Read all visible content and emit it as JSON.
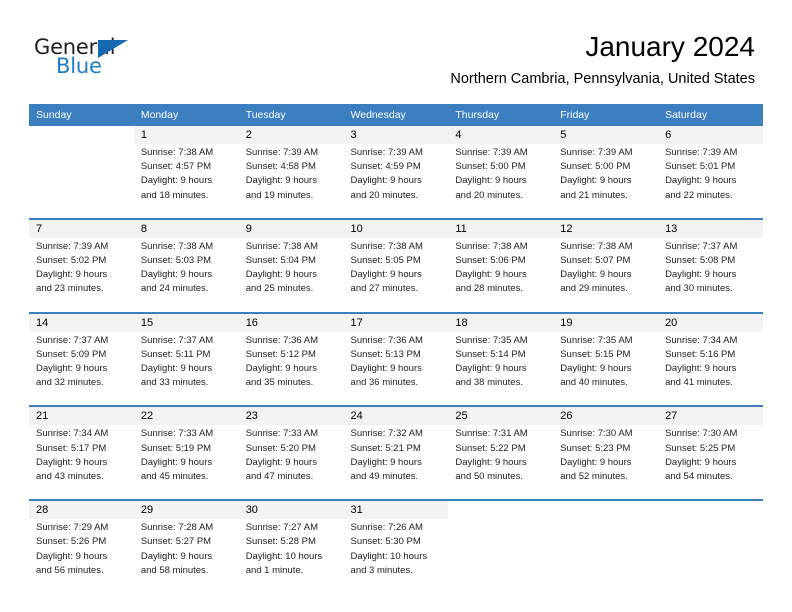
{
  "brand": {
    "name_top": "General",
    "name_bottom": "Blue",
    "accent_color": "#1668b0",
    "text_color": "#231f20"
  },
  "header": {
    "title": "January 2024",
    "subtitle": "Northern Cambria, Pennsylvania, United States",
    "header_bg": "#3c7fc0",
    "daynum_bg": "#f2f2f2"
  },
  "weekdays": [
    "Sunday",
    "Monday",
    "Tuesday",
    "Wednesday",
    "Thursday",
    "Friday",
    "Saturday"
  ],
  "weeks": [
    {
      "days": [
        {
          "date": "",
          "sunrise": "",
          "sunset": "",
          "daylight1": "",
          "daylight2": ""
        },
        {
          "date": "1",
          "sunrise": "Sunrise: 7:38 AM",
          "sunset": "Sunset: 4:57 PM",
          "daylight1": "Daylight: 9 hours",
          "daylight2": "and 18 minutes."
        },
        {
          "date": "2",
          "sunrise": "Sunrise: 7:39 AM",
          "sunset": "Sunset: 4:58 PM",
          "daylight1": "Daylight: 9 hours",
          "daylight2": "and 19 minutes."
        },
        {
          "date": "3",
          "sunrise": "Sunrise: 7:39 AM",
          "sunset": "Sunset: 4:59 PM",
          "daylight1": "Daylight: 9 hours",
          "daylight2": "and 20 minutes."
        },
        {
          "date": "4",
          "sunrise": "Sunrise: 7:39 AM",
          "sunset": "Sunset: 5:00 PM",
          "daylight1": "Daylight: 9 hours",
          "daylight2": "and 20 minutes."
        },
        {
          "date": "5",
          "sunrise": "Sunrise: 7:39 AM",
          "sunset": "Sunset: 5:00 PM",
          "daylight1": "Daylight: 9 hours",
          "daylight2": "and 21 minutes."
        },
        {
          "date": "6",
          "sunrise": "Sunrise: 7:39 AM",
          "sunset": "Sunset: 5:01 PM",
          "daylight1": "Daylight: 9 hours",
          "daylight2": "and 22 minutes."
        }
      ]
    },
    {
      "days": [
        {
          "date": "7",
          "sunrise": "Sunrise: 7:39 AM",
          "sunset": "Sunset: 5:02 PM",
          "daylight1": "Daylight: 9 hours",
          "daylight2": "and 23 minutes."
        },
        {
          "date": "8",
          "sunrise": "Sunrise: 7:38 AM",
          "sunset": "Sunset: 5:03 PM",
          "daylight1": "Daylight: 9 hours",
          "daylight2": "and 24 minutes."
        },
        {
          "date": "9",
          "sunrise": "Sunrise: 7:38 AM",
          "sunset": "Sunset: 5:04 PM",
          "daylight1": "Daylight: 9 hours",
          "daylight2": "and 25 minutes."
        },
        {
          "date": "10",
          "sunrise": "Sunrise: 7:38 AM",
          "sunset": "Sunset: 5:05 PM",
          "daylight1": "Daylight: 9 hours",
          "daylight2": "and 27 minutes."
        },
        {
          "date": "11",
          "sunrise": "Sunrise: 7:38 AM",
          "sunset": "Sunset: 5:06 PM",
          "daylight1": "Daylight: 9 hours",
          "daylight2": "and 28 minutes."
        },
        {
          "date": "12",
          "sunrise": "Sunrise: 7:38 AM",
          "sunset": "Sunset: 5:07 PM",
          "daylight1": "Daylight: 9 hours",
          "daylight2": "and 29 minutes."
        },
        {
          "date": "13",
          "sunrise": "Sunrise: 7:37 AM",
          "sunset": "Sunset: 5:08 PM",
          "daylight1": "Daylight: 9 hours",
          "daylight2": "and 30 minutes."
        }
      ]
    },
    {
      "days": [
        {
          "date": "14",
          "sunrise": "Sunrise: 7:37 AM",
          "sunset": "Sunset: 5:09 PM",
          "daylight1": "Daylight: 9 hours",
          "daylight2": "and 32 minutes."
        },
        {
          "date": "15",
          "sunrise": "Sunrise: 7:37 AM",
          "sunset": "Sunset: 5:11 PM",
          "daylight1": "Daylight: 9 hours",
          "daylight2": "and 33 minutes."
        },
        {
          "date": "16",
          "sunrise": "Sunrise: 7:36 AM",
          "sunset": "Sunset: 5:12 PM",
          "daylight1": "Daylight: 9 hours",
          "daylight2": "and 35 minutes."
        },
        {
          "date": "17",
          "sunrise": "Sunrise: 7:36 AM",
          "sunset": "Sunset: 5:13 PM",
          "daylight1": "Daylight: 9 hours",
          "daylight2": "and 36 minutes."
        },
        {
          "date": "18",
          "sunrise": "Sunrise: 7:35 AM",
          "sunset": "Sunset: 5:14 PM",
          "daylight1": "Daylight: 9 hours",
          "daylight2": "and 38 minutes."
        },
        {
          "date": "19",
          "sunrise": "Sunrise: 7:35 AM",
          "sunset": "Sunset: 5:15 PM",
          "daylight1": "Daylight: 9 hours",
          "daylight2": "and 40 minutes."
        },
        {
          "date": "20",
          "sunrise": "Sunrise: 7:34 AM",
          "sunset": "Sunset: 5:16 PM",
          "daylight1": "Daylight: 9 hours",
          "daylight2": "and 41 minutes."
        }
      ]
    },
    {
      "days": [
        {
          "date": "21",
          "sunrise": "Sunrise: 7:34 AM",
          "sunset": "Sunset: 5:17 PM",
          "daylight1": "Daylight: 9 hours",
          "daylight2": "and 43 minutes."
        },
        {
          "date": "22",
          "sunrise": "Sunrise: 7:33 AM",
          "sunset": "Sunset: 5:19 PM",
          "daylight1": "Daylight: 9 hours",
          "daylight2": "and 45 minutes."
        },
        {
          "date": "23",
          "sunrise": "Sunrise: 7:33 AM",
          "sunset": "Sunset: 5:20 PM",
          "daylight1": "Daylight: 9 hours",
          "daylight2": "and 47 minutes."
        },
        {
          "date": "24",
          "sunrise": "Sunrise: 7:32 AM",
          "sunset": "Sunset: 5:21 PM",
          "daylight1": "Daylight: 9 hours",
          "daylight2": "and 49 minutes."
        },
        {
          "date": "25",
          "sunrise": "Sunrise: 7:31 AM",
          "sunset": "Sunset: 5:22 PM",
          "daylight1": "Daylight: 9 hours",
          "daylight2": "and 50 minutes."
        },
        {
          "date": "26",
          "sunrise": "Sunrise: 7:30 AM",
          "sunset": "Sunset: 5:23 PM",
          "daylight1": "Daylight: 9 hours",
          "daylight2": "and 52 minutes."
        },
        {
          "date": "27",
          "sunrise": "Sunrise: 7:30 AM",
          "sunset": "Sunset: 5:25 PM",
          "daylight1": "Daylight: 9 hours",
          "daylight2": "and 54 minutes."
        }
      ]
    },
    {
      "days": [
        {
          "date": "28",
          "sunrise": "Sunrise: 7:29 AM",
          "sunset": "Sunset: 5:26 PM",
          "daylight1": "Daylight: 9 hours",
          "daylight2": "and 56 minutes."
        },
        {
          "date": "29",
          "sunrise": "Sunrise: 7:28 AM",
          "sunset": "Sunset: 5:27 PM",
          "daylight1": "Daylight: 9 hours",
          "daylight2": "and 58 minutes."
        },
        {
          "date": "30",
          "sunrise": "Sunrise: 7:27 AM",
          "sunset": "Sunset: 5:28 PM",
          "daylight1": "Daylight: 10 hours",
          "daylight2": "and 1 minute."
        },
        {
          "date": "31",
          "sunrise": "Sunrise: 7:26 AM",
          "sunset": "Sunset: 5:30 PM",
          "daylight1": "Daylight: 10 hours",
          "daylight2": "and 3 minutes."
        },
        {
          "date": "",
          "sunrise": "",
          "sunset": "",
          "daylight1": "",
          "daylight2": ""
        },
        {
          "date": "",
          "sunrise": "",
          "sunset": "",
          "daylight1": "",
          "daylight2": ""
        },
        {
          "date": "",
          "sunrise": "",
          "sunset": "",
          "daylight1": "",
          "daylight2": ""
        }
      ]
    }
  ]
}
